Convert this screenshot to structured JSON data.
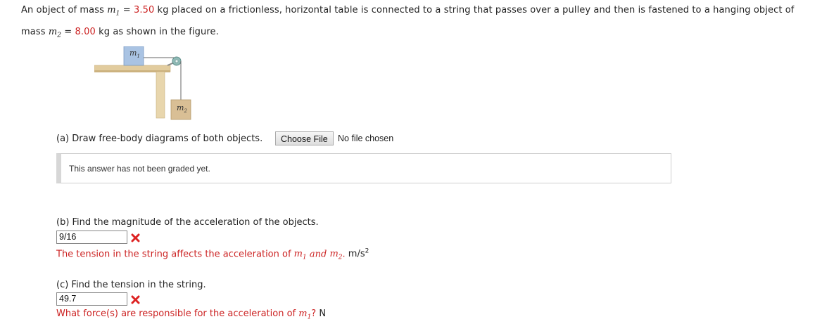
{
  "problem": {
    "line1_a": "An object of mass ",
    "m1_sym": "m",
    "m1_sub": "1",
    "eq1": " = ",
    "m1_value": "3.50",
    "line1_b": " kg placed on a frictionless, horizontal table is connected to a string that passes over a pulley and then is fastened to a hanging object of",
    "line2_a": "mass ",
    "m2_sym": "m",
    "m2_sub": "2",
    "eq2": " = ",
    "m2_value": "8.00",
    "line2_b": " kg as shown in the figure."
  },
  "figure": {
    "m1_label": "m",
    "m1_sub": "1",
    "m2_label": "m",
    "m2_sub": "2",
    "colors": {
      "block1": "#a9c3e3",
      "block2": "#d9bf95",
      "table": "#e2cc9e",
      "pulley": "#8fb9b5"
    }
  },
  "part_a": {
    "prompt": "(a) Draw free-body diagrams of both objects.",
    "choose_file": "Choose File",
    "file_status": "No file chosen",
    "graded_note": "This answer has not been graded yet."
  },
  "part_b": {
    "prompt": "(b) Find the magnitude of the acceleration of the objects.",
    "answer": "9/16",
    "feedback_a": "The tension in the string affects the acceleration of ",
    "fb_m1": "m",
    "fb_m1_sub": "1",
    "fb_and": " and ",
    "fb_m2": "m",
    "fb_m2_sub": "2",
    "fb_end": ".",
    "unit_base": " m/s",
    "unit_exp": "2"
  },
  "part_c": {
    "prompt": "(c) Find the tension in the string.",
    "answer": "49.7",
    "feedback_a": "What force(s) are responsible for the acceleration of ",
    "fb_m1": "m",
    "fb_m1_sub": "1",
    "fb_end": "?",
    "unit": " N"
  },
  "icons": {
    "incorrect": "x-mark-icon",
    "color": "#dd2222"
  }
}
